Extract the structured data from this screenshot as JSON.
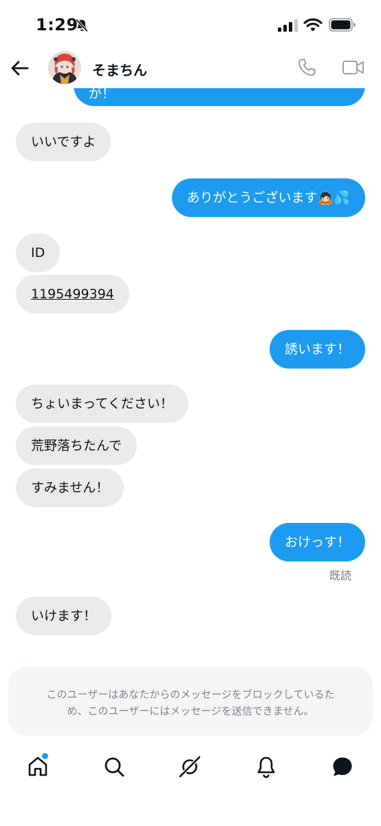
{
  "status_bar": {
    "time": "1:29",
    "icons": [
      "bell-slash-icon",
      "signal-icon",
      "wifi-icon",
      "battery-icon"
    ]
  },
  "header": {
    "contact_name": "そまちん",
    "icons": [
      "back-arrow-icon",
      "phone-icon",
      "video-camera-icon"
    ]
  },
  "messages": [
    {
      "from": "me",
      "text": "が！",
      "partial": true
    },
    {
      "from": "them",
      "text": "いいですよ"
    },
    {
      "from": "me",
      "text": "ありがとうございます🙇🏻💦"
    },
    {
      "from": "them",
      "text": "ID"
    },
    {
      "from": "them",
      "text": "1195499394",
      "link": true
    },
    {
      "from": "me",
      "text": "誘います！"
    },
    {
      "from": "them",
      "text": "ちょいまってください！"
    },
    {
      "from": "them",
      "text": "荒野落ちたんで"
    },
    {
      "from": "them",
      "text": "すみません！"
    },
    {
      "from": "me",
      "text": "おけっす！"
    },
    {
      "from": "them",
      "text": "いけます！"
    }
  ],
  "read_receipt": "既読",
  "blocked_notice": "このユーザーはあなたからのメッセージをブロックしているた\nめ、このユーザーにはメッセージを送信できません。",
  "bottom_nav": {
    "items": [
      "home-icon",
      "search-icon",
      "grok-icon",
      "notifications-bell-icon",
      "messages-icon"
    ],
    "home_has_badge": true
  },
  "colors": {
    "accent": "#1d9bf0",
    "incoming_bubble": "#eaeaea",
    "notice_bg": "#f4f5f6",
    "muted_text": "#7d848c"
  }
}
